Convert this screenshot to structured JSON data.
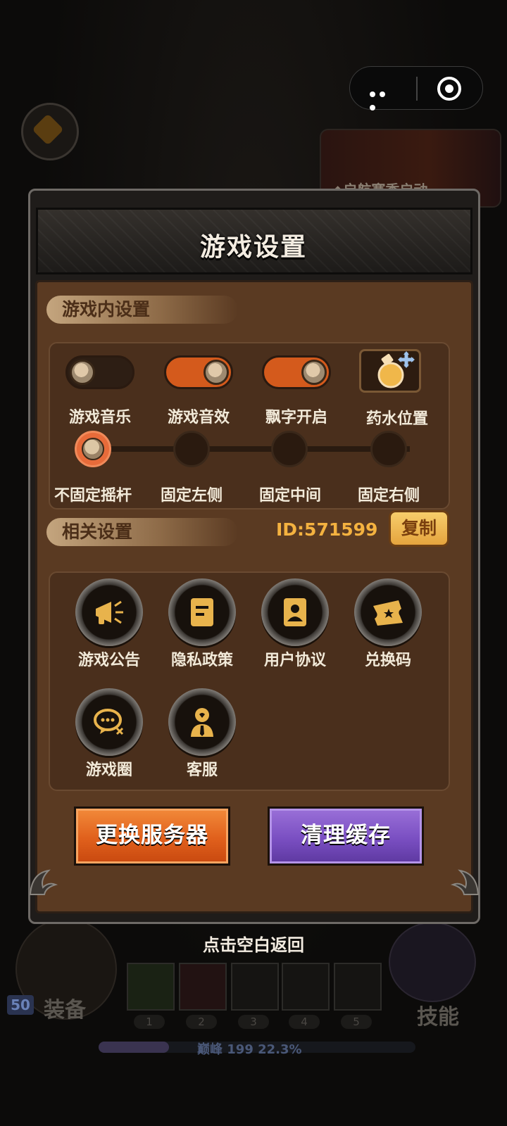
{
  "capsule": {
    "menu_icon": "more-dots-icon",
    "close_icon": "target-close-icon"
  },
  "background": {
    "event_banner": "◆启航赛季启动",
    "equip_label": "装备",
    "skill_label": "技能",
    "level_badge": "50",
    "xp_text": "巅峰 199   22.3%",
    "xp_progress": 0.223,
    "slot_numbers": [
      "1",
      "2",
      "3",
      "4",
      "5"
    ]
  },
  "dialog": {
    "title": "游戏设置",
    "in_game_section": "游戏内设置",
    "options": [
      {
        "label": "游戏音乐",
        "state": "off"
      },
      {
        "label": "游戏音效",
        "state": "on"
      },
      {
        "label": "飘字开启",
        "state": "on"
      },
      {
        "label": "药水位置",
        "icon": "potion-move-icon"
      }
    ],
    "joystick": [
      {
        "label": "不固定摇杆",
        "selected": true
      },
      {
        "label": "固定左侧",
        "selected": false
      },
      {
        "label": "固定中间",
        "selected": false
      },
      {
        "label": "固定右侧",
        "selected": false
      }
    ],
    "related_section": "相关设置",
    "id_text": "ID:571599",
    "copy_label": "复制",
    "links": [
      {
        "label": "游戏公告",
        "icon": "megaphone-icon"
      },
      {
        "label": "隐私政策",
        "icon": "document-icon"
      },
      {
        "label": "用户协议",
        "icon": "user-card-icon"
      },
      {
        "label": "兑换码",
        "icon": "ticket-icon"
      },
      {
        "label": "游戏圈",
        "icon": "chat-bubble-icon"
      },
      {
        "label": "客服",
        "icon": "customer-service-icon"
      }
    ],
    "change_server_label": "更换服务器",
    "clear_cache_label": "清理缓存"
  },
  "back_hint": "点击空白返回",
  "colors": {
    "toggle_on": "#d45a1c",
    "server_button": "#e0601c",
    "cache_button": "#7a4fc2",
    "id_text": "#f4b240"
  }
}
